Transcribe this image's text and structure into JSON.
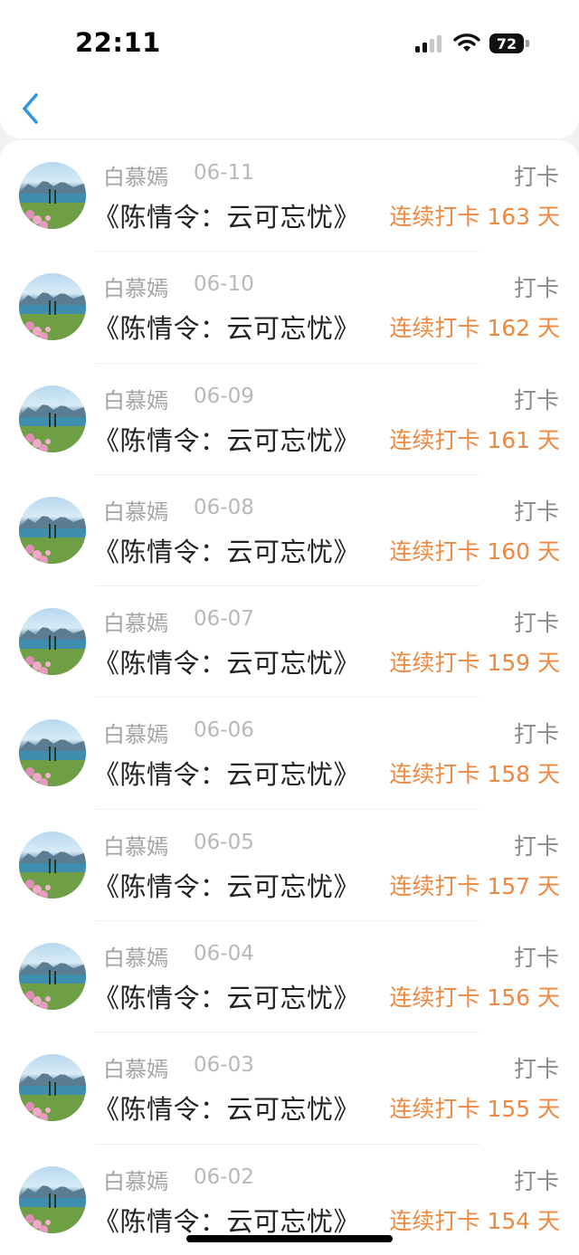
{
  "status_bar": {
    "time": "22:11",
    "battery": "72"
  },
  "items": [
    {
      "user": "白慕嫣",
      "date": "06-11",
      "action": "打卡",
      "book": "《陈情令：云可忘忧》",
      "streak": "连续打卡 163 天"
    },
    {
      "user": "白慕嫣",
      "date": "06-10",
      "action": "打卡",
      "book": "《陈情令：云可忘忧》",
      "streak": "连续打卡 162 天"
    },
    {
      "user": "白慕嫣",
      "date": "06-09",
      "action": "打卡",
      "book": "《陈情令：云可忘忧》",
      "streak": "连续打卡 161 天"
    },
    {
      "user": "白慕嫣",
      "date": "06-08",
      "action": "打卡",
      "book": "《陈情令：云可忘忧》",
      "streak": "连续打卡 160 天"
    },
    {
      "user": "白慕嫣",
      "date": "06-07",
      "action": "打卡",
      "book": "《陈情令：云可忘忧》",
      "streak": "连续打卡 159 天"
    },
    {
      "user": "白慕嫣",
      "date": "06-06",
      "action": "打卡",
      "book": "《陈情令：云可忘忧》",
      "streak": "连续打卡 158 天"
    },
    {
      "user": "白慕嫣",
      "date": "06-05",
      "action": "打卡",
      "book": "《陈情令：云可忘忧》",
      "streak": "连续打卡 157 天"
    },
    {
      "user": "白慕嫣",
      "date": "06-04",
      "action": "打卡",
      "book": "《陈情令：云可忘忧》",
      "streak": "连续打卡 156 天"
    },
    {
      "user": "白慕嫣",
      "date": "06-03",
      "action": "打卡",
      "book": "《陈情令：云可忘忧》",
      "streak": "连续打卡 155 天"
    },
    {
      "user": "白慕嫣",
      "date": "06-02",
      "action": "打卡",
      "book": "《陈情令：云可忘忧》",
      "streak": "连续打卡 154 天"
    }
  ],
  "colors": {
    "accent": "#2f95e8",
    "streak": "#ef8840",
    "muted": "#a4a4a8"
  },
  "icons": {
    "back": "chevron-left-icon"
  }
}
